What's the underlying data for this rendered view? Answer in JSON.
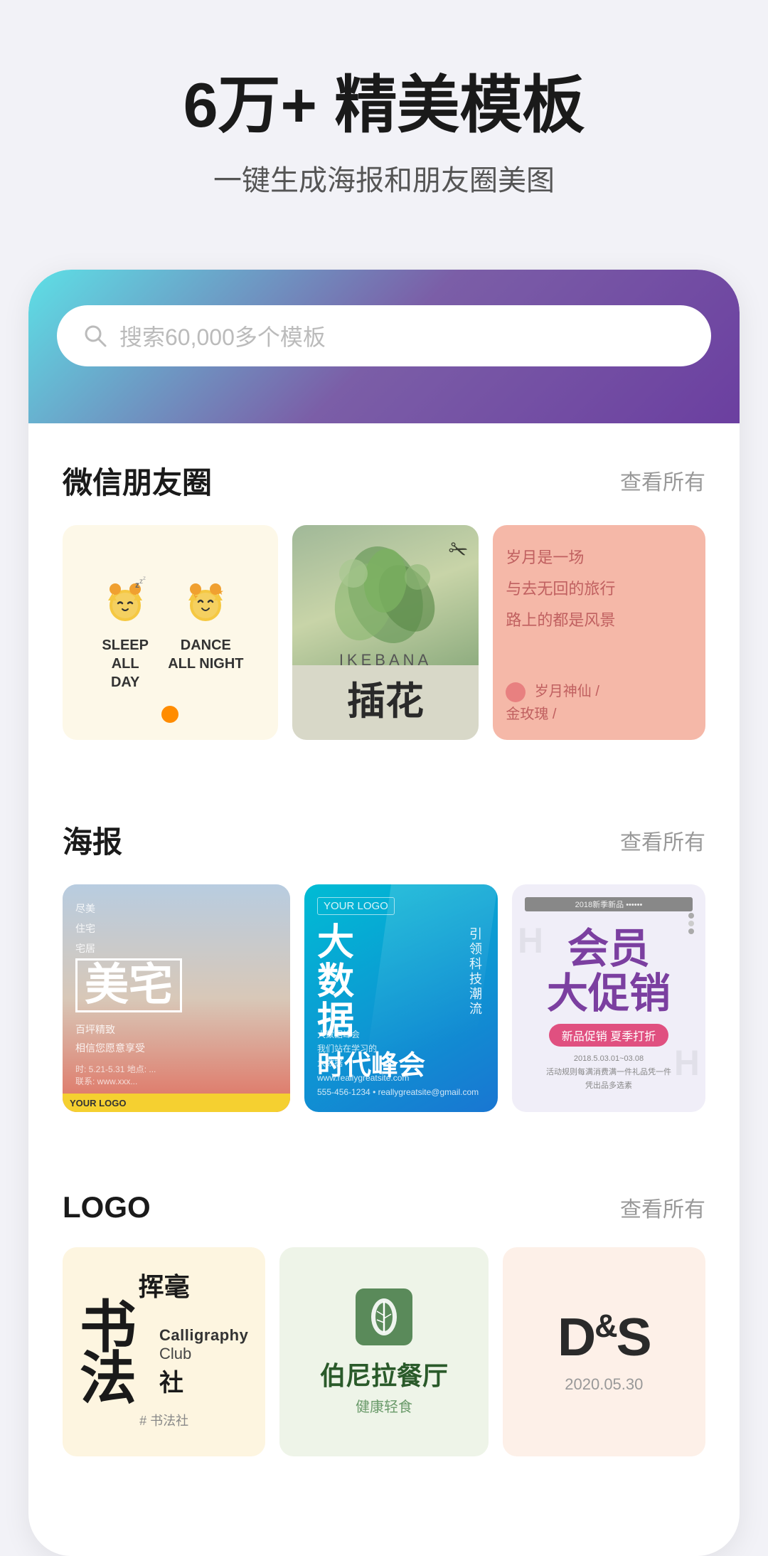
{
  "hero": {
    "title": "6万+ 精美模板",
    "subtitle": "一键生成海报和朋友圈美图"
  },
  "search": {
    "placeholder": "搜索60,000多个模板"
  },
  "sections": {
    "wechat": {
      "title": "微信朋友圈",
      "more": "查看所有",
      "cards": [
        {
          "type": "sleep-dance",
          "char1_label": "SLEEP\nALL\nDAY",
          "char2_label": "DANCE\nALL NIGHT"
        },
        {
          "type": "ikebana",
          "en": "IKEBANA",
          "zh": "插花"
        },
        {
          "type": "poem",
          "lines": [
            "岁月是一场",
            "与去无回的旅行",
            "路上的都是风景"
          ],
          "author": "岁月神仙 /\n金玫瑰 /"
        }
      ]
    },
    "poster": {
      "title": "海报",
      "more": "查看所有",
      "cards": [
        {
          "main": "美宅",
          "sub_lines": [
            "尽美\n住宅\n宅居"
          ],
          "bottom": "YOUR LOGO"
        },
        {
          "logo": "YOUR LOGO",
          "main": "大数据",
          "title": "时代峰会",
          "side": "引领科技潮流"
        },
        {
          "year": "2018新季新品",
          "main": "会员\n大促销",
          "sub": "新品促销 夏季打折"
        }
      ]
    },
    "logo": {
      "title": "LOGO",
      "more": "查看所有",
      "cards": [
        {
          "zh1": "挥毫",
          "zh2": "书",
          "zh3": "法",
          "en1": "Calligraphy",
          "en2": "Club",
          "zh4": "社",
          "hash": "#"
        },
        {
          "name_zh": "伯尼拉餐厅",
          "name_en": "健康轻食"
        },
        {
          "letters": "D&S",
          "date": "2020.05.30"
        }
      ]
    }
  }
}
